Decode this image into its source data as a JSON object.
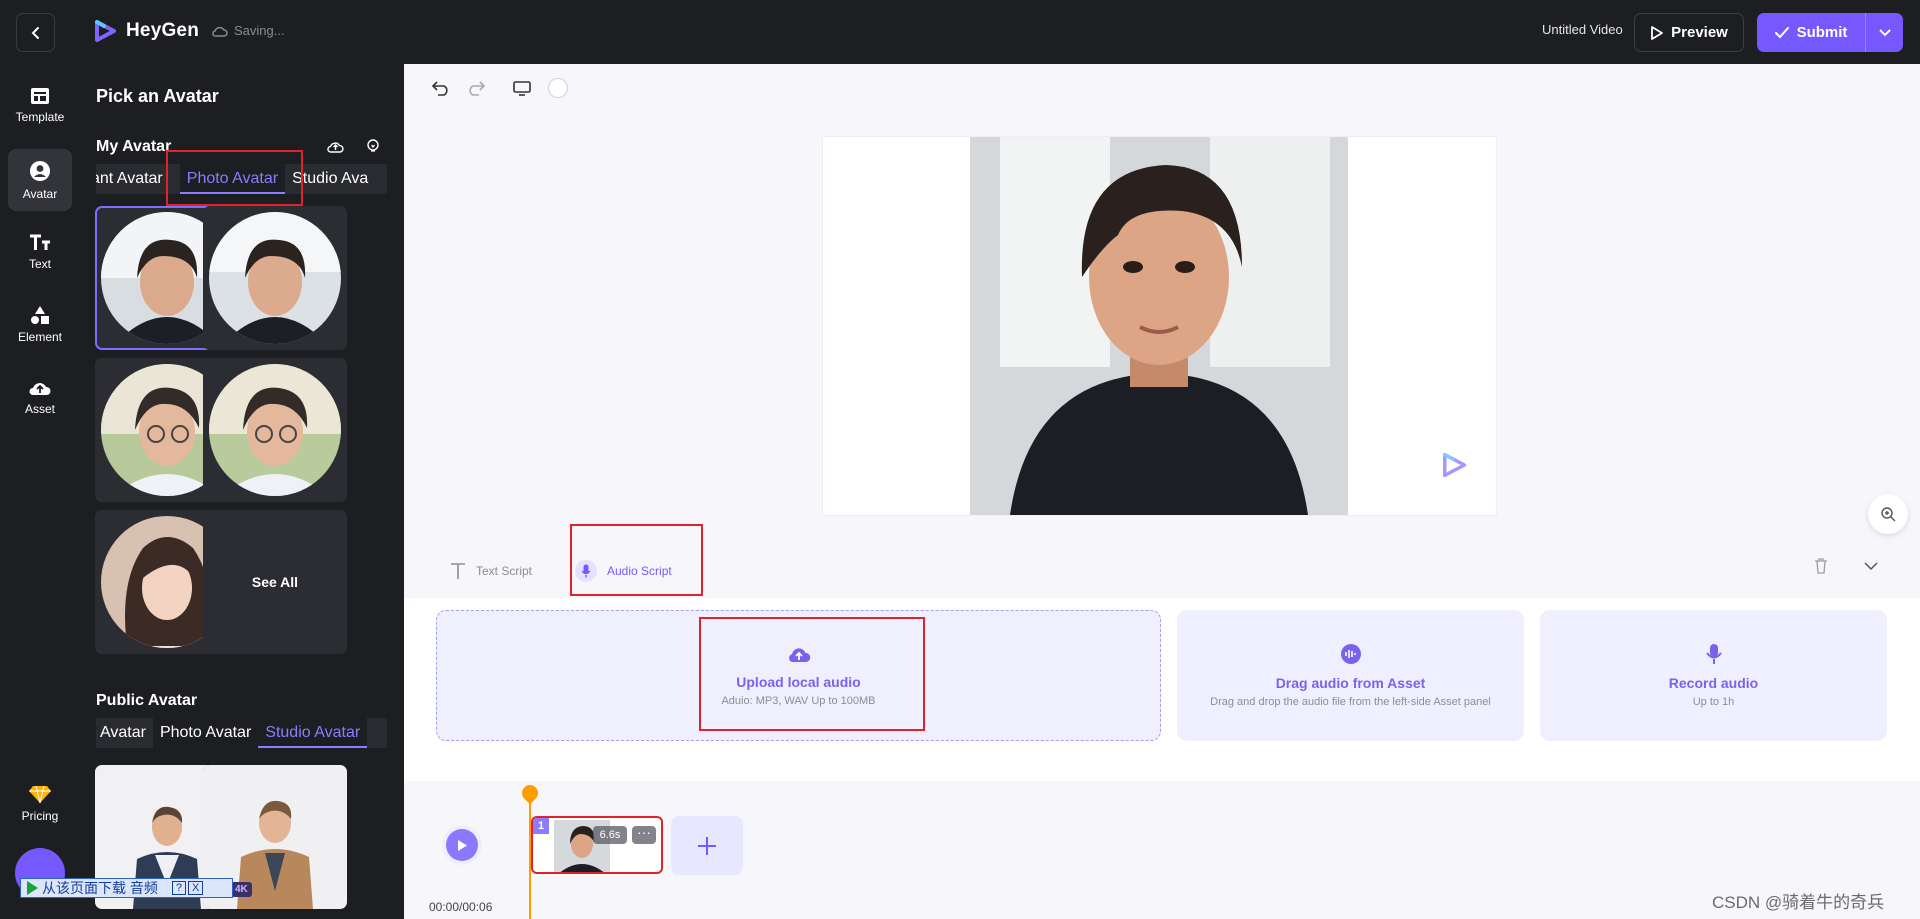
{
  "header": {
    "brand": "HeyGen",
    "saving_status": "Saving...",
    "video_title": "Untitled Video",
    "preview_label": "Preview",
    "submit_label": "Submit"
  },
  "rail": {
    "items": [
      {
        "label": "Template",
        "icon": "template-icon"
      },
      {
        "label": "Avatar",
        "icon": "avatar-icon"
      },
      {
        "label": "Text",
        "icon": "text-icon"
      },
      {
        "label": "Element",
        "icon": "element-icon"
      },
      {
        "label": "Asset",
        "icon": "asset-icon"
      }
    ],
    "pricing_label": "Pricing"
  },
  "panel": {
    "title": "Pick an Avatar",
    "my_avatar_title": "My Avatar",
    "my_tabs": [
      "ant Avatar",
      "Photo Avatar",
      "Studio Ava"
    ],
    "see_all": "See All",
    "public_avatar_title": "Public Avatar",
    "public_tabs": [
      "Avatar",
      "Photo Avatar",
      "Studio Avatar"
    ],
    "quality_badge": "4K"
  },
  "download_bar": {
    "label": "从该页面下载 音频",
    "help": "?",
    "close": "X"
  },
  "script": {
    "text_tab": "Text Script",
    "audio_tab": "Audio Script"
  },
  "audio_options": {
    "upload_title": "Upload local audio",
    "upload_sub": "Aduio: MP3, WAV Up to 100MB",
    "drag_title": "Drag audio from Asset",
    "drag_sub": "Drag and drop the audio file from the left-side Asset panel",
    "record_title": "Record audio",
    "record_sub": "Up to 1h"
  },
  "timeline": {
    "current_time": "00:00/00:06",
    "scene_number": "1",
    "scene_duration": "6.6s",
    "scene_more": "···"
  },
  "watermark": "CSDN @骑着牛的奇兵"
}
